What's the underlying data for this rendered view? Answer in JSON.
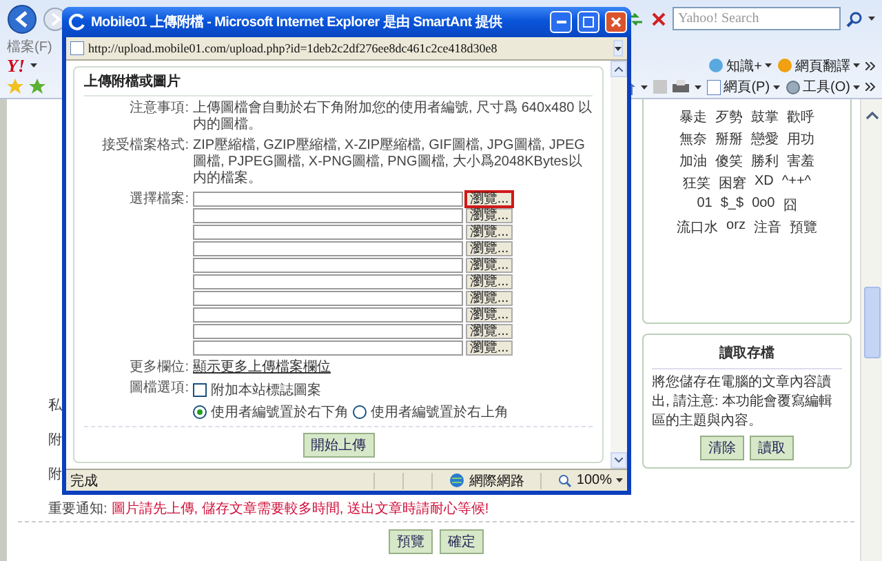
{
  "browser": {
    "menu": [
      "檔案(F)"
    ],
    "search": {
      "placeholder": "Yahoo! Search"
    },
    "logo": "Y!",
    "yahoo_toolbar": [
      "知識+",
      "網頁翻譯"
    ],
    "command_bar": [
      "網頁(P)",
      "工具(O)"
    ]
  },
  "page": {
    "form_labels": [
      "私",
      "附",
      "附"
    ],
    "notice": {
      "label": "重要通知:",
      "text": "圖片請先上傳, 儲存文章需要較多時間, 送出文章時請耐心等候!"
    },
    "emoticons": [
      [
        "暴走",
        "歹勢",
        "鼓掌",
        "歡呼"
      ],
      [
        "無奈",
        "掰掰",
        "戀愛",
        "用功"
      ],
      [
        "加油",
        "傻笑",
        "勝利",
        "害羞"
      ],
      [
        "狂笑",
        "困窘",
        "XD",
        "^++^"
      ],
      [
        "01",
        "$_$",
        "0o0",
        "囧"
      ],
      [
        "流口水",
        "orz",
        "注音",
        "預覽"
      ]
    ],
    "load_panel": {
      "title": "讀取存檔",
      "text": "將您儲存在電腦的文章內容讀出, 請注意: 本功能會覆寫編輯區的主題與內容。",
      "buttons": [
        "清除",
        "讀取"
      ]
    },
    "buttons": [
      "預覽",
      "確定"
    ]
  },
  "popup": {
    "title": "Mobile01 上傳附檔 - Microsoft Internet Explorer 是由 SmartAnt 提供",
    "address": "http://upload.mobile01.com/upload.php?id=1deb2c2df276ee8dc461c2ce418d30e8",
    "heading": "上傳附檔或圖片",
    "fields": [
      {
        "label": "注意事項:",
        "text": "上傳圖檔會自動於右下角附加您的使用者編號, 尺寸爲 640x480 以内的圖檔。"
      },
      {
        "label": "接受檔案格式:",
        "text": "ZIP壓縮檔, GZIP壓縮檔, X-ZIP壓縮檔, GIF圖檔, JPG圖檔, JPEG圖檔, PJPEG圖檔, X-PNG圖檔, PNG圖檔, 大小爲2048KBytes以内的檔案。"
      }
    ],
    "file_label": "選擇檔案:",
    "file_rows": [
      {
        "button": "瀏覽...",
        "focused": true
      },
      {
        "button": "瀏覽...",
        "focused": false
      },
      {
        "button": "瀏覽...",
        "focused": false
      },
      {
        "button": "瀏覽...",
        "focused": false
      },
      {
        "button": "瀏覽...",
        "focused": false
      },
      {
        "button": "瀏覽...",
        "focused": false
      },
      {
        "button": "瀏覽...",
        "focused": false
      },
      {
        "button": "瀏覽...",
        "focused": false
      },
      {
        "button": "瀏覽...",
        "focused": false
      },
      {
        "button": "瀏覽...",
        "focused": false
      }
    ],
    "more": {
      "label": "更多欄位:",
      "link": "顯示更多上傳檔案欄位"
    },
    "options": {
      "label": "圖檔選項:",
      "checkbox": {
        "label": "附加本站標誌圖案",
        "checked": false
      },
      "radios": [
        {
          "label": "使用者編號置於右下角",
          "selected": true
        },
        {
          "label": "使用者編號置於右上角",
          "selected": false
        }
      ]
    },
    "submit": "開始上傳",
    "status": {
      "text": "完成",
      "zone": "網際網路",
      "zoom": "100%"
    }
  }
}
